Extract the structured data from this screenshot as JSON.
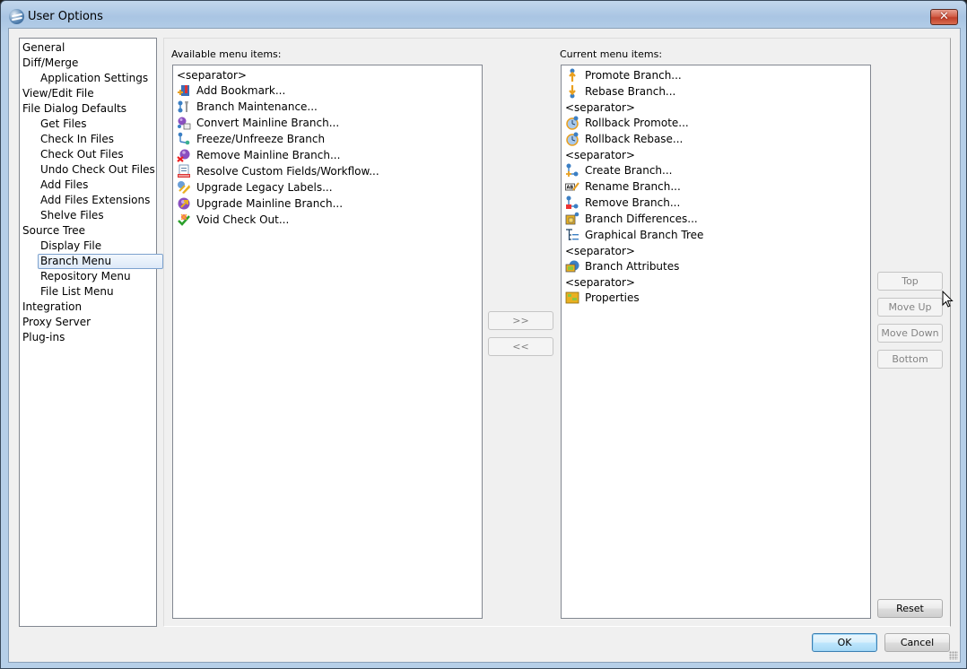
{
  "window": {
    "title": "User Options",
    "close_label": "✕"
  },
  "tree": {
    "items": [
      {
        "label": "General",
        "level": 0
      },
      {
        "label": "Diff/Merge",
        "level": 0
      },
      {
        "label": "Application Settings",
        "level": 1
      },
      {
        "label": "View/Edit File",
        "level": 0
      },
      {
        "label": "File Dialog Defaults",
        "level": 0
      },
      {
        "label": "Get Files",
        "level": 1
      },
      {
        "label": "Check In Files",
        "level": 1
      },
      {
        "label": "Check Out Files",
        "level": 1
      },
      {
        "label": "Undo Check Out Files",
        "level": 1
      },
      {
        "label": "Add Files",
        "level": 1
      },
      {
        "label": "Add Files Extensions",
        "level": 1
      },
      {
        "label": "Shelve Files",
        "level": 1
      },
      {
        "label": "Source Tree",
        "level": 0
      },
      {
        "label": "Display File",
        "level": 1
      },
      {
        "label": "Branch Menu",
        "level": 1,
        "selected": true
      },
      {
        "label": "Repository Menu",
        "level": 1
      },
      {
        "label": "File List Menu",
        "level": 1
      },
      {
        "label": "Integration",
        "level": 0
      },
      {
        "label": "Proxy Server",
        "level": 0
      },
      {
        "label": "Plug-ins",
        "level": 0
      }
    ]
  },
  "available": {
    "label": "Available menu items:",
    "items": [
      {
        "label": "<separator>",
        "icon": null
      },
      {
        "label": "Add Bookmark...",
        "icon": "add-bookmark-icon"
      },
      {
        "label": "Branch Maintenance...",
        "icon": "branch-maintenance-icon"
      },
      {
        "label": "Convert Mainline Branch...",
        "icon": "convert-mainline-icon"
      },
      {
        "label": "Freeze/Unfreeze Branch",
        "icon": "freeze-branch-icon"
      },
      {
        "label": "Remove Mainline Branch...",
        "icon": "remove-mainline-icon"
      },
      {
        "label": "Resolve Custom Fields/Workflow...",
        "icon": "resolve-fields-icon"
      },
      {
        "label": "Upgrade Legacy Labels...",
        "icon": "upgrade-labels-icon"
      },
      {
        "label": "Upgrade Mainline Branch...",
        "icon": "upgrade-mainline-icon"
      },
      {
        "label": "Void Check Out...",
        "icon": "void-checkout-icon"
      }
    ]
  },
  "current": {
    "label": "Current menu items:",
    "items": [
      {
        "label": "Promote Branch...",
        "icon": "promote-branch-icon"
      },
      {
        "label": "Rebase Branch...",
        "icon": "rebase-branch-icon"
      },
      {
        "label": "<separator>",
        "icon": null
      },
      {
        "label": "Rollback Promote...",
        "icon": "rollback-promote-icon"
      },
      {
        "label": "Rollback Rebase...",
        "icon": "rollback-rebase-icon"
      },
      {
        "label": "<separator>",
        "icon": null
      },
      {
        "label": "Create Branch...",
        "icon": "create-branch-icon"
      },
      {
        "label": "Rename Branch...",
        "icon": "rename-branch-icon"
      },
      {
        "label": "Remove Branch...",
        "icon": "remove-branch-icon"
      },
      {
        "label": "Branch Differences...",
        "icon": "branch-differences-icon"
      },
      {
        "label": "Graphical Branch Tree",
        "icon": "graphical-tree-icon"
      },
      {
        "label": "<separator>",
        "icon": null
      },
      {
        "label": "Branch Attributes",
        "icon": "branch-attributes-icon"
      },
      {
        "label": "<separator>",
        "icon": null
      },
      {
        "label": "Properties",
        "icon": "properties-icon"
      }
    ]
  },
  "buttons": {
    "add": ">>",
    "remove": "<<",
    "top": "Top",
    "move_up": "Move Up",
    "move_down": "Move Down",
    "bottom": "Bottom",
    "reset": "Reset",
    "ok": "OK",
    "cancel": "Cancel"
  }
}
